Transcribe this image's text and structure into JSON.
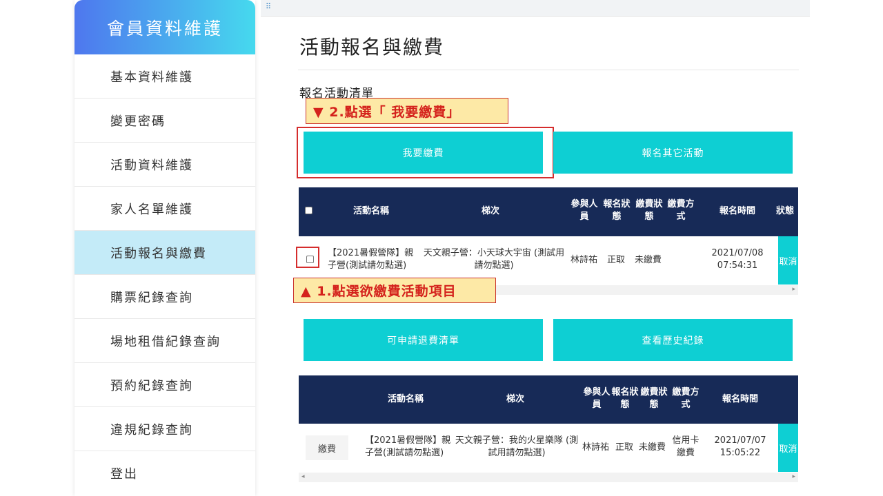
{
  "sidebar": {
    "title": "會員資料維護",
    "items": [
      {
        "label": "基本資料維護"
      },
      {
        "label": "變更密碼"
      },
      {
        "label": "活動資料維護"
      },
      {
        "label": "家人名單維護"
      },
      {
        "label": "活動報名與繳費"
      },
      {
        "label": "購票紀錄查詢"
      },
      {
        "label": "場地租借紀錄查詢"
      },
      {
        "label": "預約紀錄查詢"
      },
      {
        "label": "違規紀錄查詢"
      },
      {
        "label": "登出"
      }
    ]
  },
  "topbar": {
    "grip": "⠿"
  },
  "main": {
    "title": "活動報名與繳費",
    "section_label": "報名活動清單",
    "buttons": {
      "pay": "我要繳費",
      "register_other": "報名其它活動",
      "refund_list": "可申請退費清單",
      "history": "查看歷史紀錄"
    },
    "annotations": {
      "step2": "▼ 2.點選「 我要繳費」",
      "step1": "▲ 1.點選欲繳費活動項目"
    },
    "table1": {
      "headers": [
        "活動名稱",
        "梯次",
        "參與人員",
        "報名狀態",
        "繳費狀態",
        "繳費方式",
        "報名時間",
        "狀態"
      ],
      "header_lines": {
        "participant": [
          "參與人",
          "員"
        ],
        "reg_status": [
          "報名狀",
          "態"
        ],
        "pay_status": [
          "繳費狀",
          "態"
        ],
        "pay_method": [
          "繳費方",
          "式"
        ]
      },
      "row": {
        "activity": [
          "【2021暑假營隊】親",
          "子營(測試請勿點選)"
        ],
        "session": [
          "天文親子營：小天球大宇宙 (測試用",
          "請勿點選)"
        ],
        "participant": "林詩祐",
        "reg_status": "正取",
        "pay_status": "未繳費",
        "time": [
          "2021/07/08",
          "07:54:31"
        ],
        "action": "取消"
      }
    },
    "table2": {
      "headers": [
        "活動名稱",
        "梯次",
        "參與人員",
        "報名狀態",
        "繳費狀態",
        "繳費方式",
        "報名時間"
      ],
      "header_lines": {
        "participant": [
          "參與人",
          "員"
        ],
        "reg_status": [
          "報名狀",
          "態"
        ],
        "pay_status": [
          "繳費狀",
          "態"
        ],
        "pay_method": [
          "繳費方",
          "式"
        ]
      },
      "row": {
        "pay": "繳費",
        "activity": [
          "【2021暑假營隊】親",
          "子營(測試請勿點選)"
        ],
        "session": [
          "天文親子營：我的火星樂隊 (測",
          "試用請勿點選)"
        ],
        "participant": "林詩祐",
        "reg_status": "正取",
        "pay_status": "未繳費",
        "pay_method": [
          "信用卡",
          "繳費"
        ],
        "time": [
          "2021/07/07",
          "15:05:22"
        ],
        "action": "取消"
      }
    },
    "scroll_arrows": {
      "left": "◂",
      "right": "▸"
    }
  },
  "colors": {
    "accent": "#0ecfd3",
    "header_bg": "#172a57",
    "annotation_red": "#d4221c",
    "annotation_bg": "#fde9a6",
    "sidebar_active": "#c4ebf8"
  }
}
